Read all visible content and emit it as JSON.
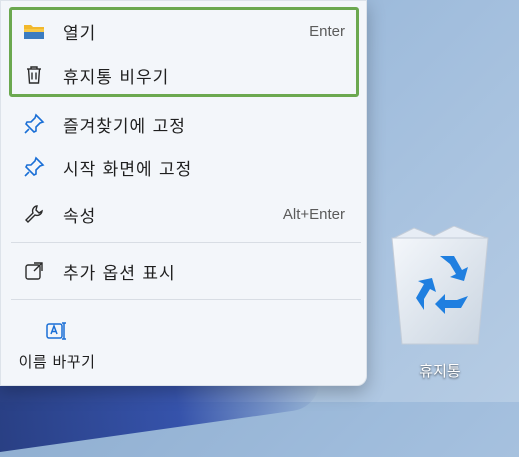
{
  "context_menu": {
    "items": [
      {
        "label": "열기",
        "icon": "folder-icon",
        "shortcut": "Enter"
      },
      {
        "label": "휴지통 비우기",
        "icon": "trash-icon",
        "shortcut": ""
      },
      {
        "label": "즐겨찾기에 고정",
        "icon": "pin-icon",
        "shortcut": ""
      },
      {
        "label": "시작 화면에 고정",
        "icon": "pin-icon",
        "shortcut": ""
      },
      {
        "label": "속성",
        "icon": "wrench-icon",
        "shortcut": "Alt+Enter"
      },
      {
        "label": "추가 옵션 표시",
        "icon": "open-external-icon",
        "shortcut": ""
      }
    ],
    "quick_actions": [
      {
        "label": "이름 바꾸기",
        "icon": "rename-icon"
      }
    ],
    "highlight_color": "#6ba84f"
  },
  "desktop": {
    "icon_label": "휴지통",
    "icon": "recycle-bin-icon"
  },
  "colors": {
    "menu_background": "#f3f6fa",
    "accent_blue": "#1a6fd6",
    "folder_yellow": "#f2b82b"
  }
}
